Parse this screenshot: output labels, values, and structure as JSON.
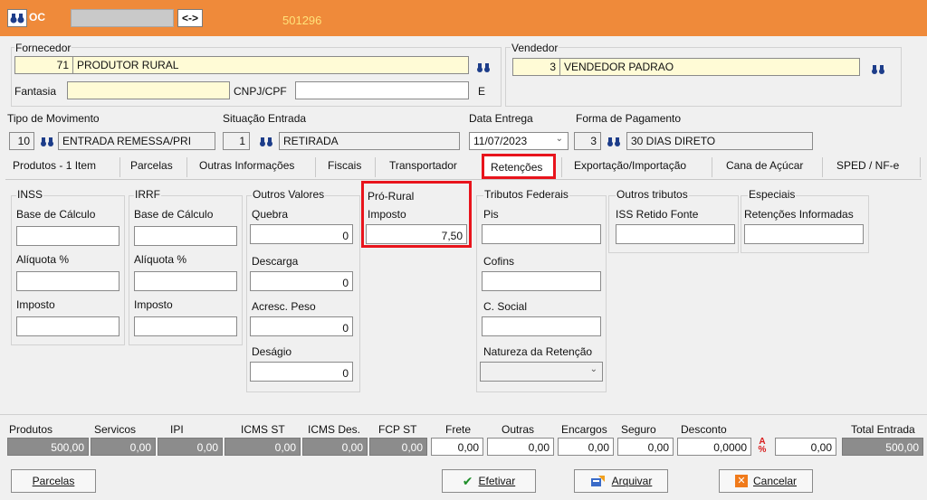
{
  "header": {
    "code_label": "OC",
    "arrow_button": "<->",
    "document_number": "501296"
  },
  "fornecedor": {
    "label": "Fornecedor",
    "code": "71",
    "name": "PRODUTOR RURAL",
    "fantasia_label": "Fantasia",
    "fantasia_value": "",
    "cnpj_label": "CNPJ/CPF",
    "cnpj_value": "",
    "e_label": "E"
  },
  "vendedor": {
    "label": "Vendedor",
    "code": "3",
    "name": "VENDEDOR PADRAO"
  },
  "movimento": {
    "label": "Tipo  de Movimento",
    "code": "10",
    "name": "ENTRADA REMESSA/PRI"
  },
  "situacao": {
    "label": "Situação Entrada",
    "code": "1",
    "name": "RETIRADA"
  },
  "data_entrega": {
    "label": "Data Entrega",
    "value": "11/07/2023"
  },
  "pagamento": {
    "label": "Forma de Pagamento",
    "code": "3",
    "name": "30 DIAS DIRETO"
  },
  "tabs": [
    "Produtos - 1 Item",
    "Parcelas",
    "Outras Informações",
    "Fiscais",
    "Transportador",
    "Retenções",
    "Exportação/Importação",
    "Cana de Açúcar",
    "SPED / NF-e"
  ],
  "inss": {
    "title": "INSS",
    "base_label": "Base de Cálculo",
    "base_value": "",
    "aliquota_label": "Alíquota %",
    "aliquota_value": "",
    "imposto_label": "Imposto",
    "imposto_value": ""
  },
  "irrf": {
    "title": "IRRF",
    "base_label": "Base de Cálculo",
    "base_value": "",
    "aliquota_label": "Alíquota %",
    "aliquota_value": "",
    "imposto_label": "Imposto",
    "imposto_value": ""
  },
  "outros_valores": {
    "title": "Outros Valores",
    "quebra_label": "Quebra",
    "quebra_value": "0",
    "descarga_label": "Descarga",
    "descarga_value": "0",
    "acresc_label": "Acresc. Peso",
    "acresc_value": "0",
    "desagio_label": "Deságio",
    "desagio_value": "0"
  },
  "pro_rural": {
    "title": "Pró-Rural",
    "imposto_label": "Imposto",
    "imposto_value": "7,50"
  },
  "tributos_federais": {
    "title": "Tributos Federais",
    "pis_label": "Pis",
    "pis_value": "",
    "cofins_label": "Cofins",
    "cofins_value": "",
    "csocial_label": "C. Social",
    "csocial_value": "",
    "natureza_label": "Natureza da Retenção",
    "natureza_value": ""
  },
  "outros_tributos": {
    "title": "Outros tributos",
    "iss_label": "ISS Retido Fonte",
    "iss_value": ""
  },
  "especiais": {
    "title": "Especiais",
    "retencoes_label": "Retenções Informadas",
    "retencoes_value": ""
  },
  "totals": {
    "produtos_label": "Produtos",
    "produtos": "500,00",
    "servicos_label": "Servicos",
    "servicos": "0,00",
    "ipi_label": "IPI",
    "ipi": "0,00",
    "icms_st_label": "ICMS ST",
    "icms_st": "0,00",
    "icms_des_label": "ICMS Des.",
    "icms_des": "0,00",
    "fcp_st_label": "FCP ST",
    "fcp_st": "0,00",
    "frete_label": "Frete",
    "frete": "0,00",
    "outras_label": "Outras",
    "outras": "0,00",
    "encargos_label": "Encargos",
    "encargos": "0,00",
    "seguro_label": "Seguro",
    "seguro": "0,00",
    "desconto_label": "Desconto",
    "desconto_pct": "0,0000",
    "desconto": "0,00",
    "total_label": "Total Entrada",
    "total": "500,00"
  },
  "buttons": {
    "parcelas": "Parcelas",
    "efetivar": "Efetivar",
    "arquivar": "Arquivar",
    "cancelar": "Cancelar"
  },
  "colors": {
    "topbar": "#ef8a3a",
    "highlight": "#e8141c",
    "document_number": "#ffe27a"
  }
}
